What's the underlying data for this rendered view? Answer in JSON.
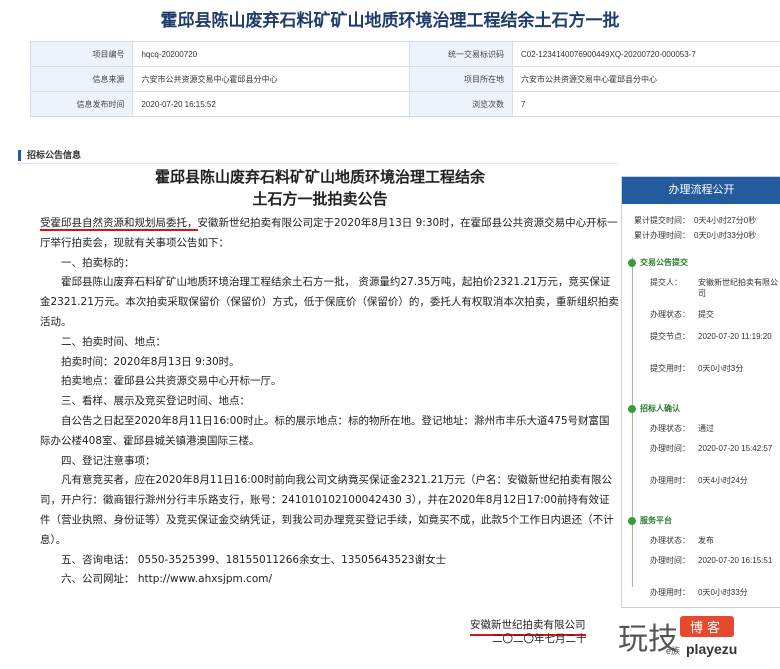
{
  "page_title": "霍邱县陈山废弃石料矿矿山地质环境治理工程结余土石方一批",
  "info": {
    "rows": [
      {
        "l1": "项目编号",
        "v1": "hqcq-20200720",
        "l2": "统一交易标识码",
        "v2": "C02-1234140076900449XQ-20200720-000053-7"
      },
      {
        "l1": "信息来源",
        "v1": "六安市公共资源交易中心霍邱县分中心",
        "l2": "项目所在地",
        "v2": "六安市公共资源交易中心霍邱县分中心"
      },
      {
        "l1": "信息发布时间",
        "v1": "2020-07-20 16:15:52",
        "l2": "浏览次数",
        "v2": "7"
      }
    ]
  },
  "section_title": "招标公告信息",
  "doc": {
    "title_line1": "霍邱县陈山废弃石料矿矿山地质环境治理工程结余",
    "title_line2": "土石方一批拍卖公告",
    "p1_hl": "受霍邱县自然资源和规划局委托，",
    "p1_rest": "安徽新世纪拍卖有限公司定于2020年8月13日 9:30时，在霍邱县公共资源交易中心开标一厅举行拍卖会，现就有关事项公告如下：",
    "h1": "一、拍卖标的：",
    "p2": "霍邱县陈山废弃石料矿矿山地质环境治理工程结余土石方一批， 资源量约27.35万吨，起拍价2321.21万元，竞买保证金2321.21万元。本次拍卖采取保留价（保留价）方式，低于保底价（保留价）的，委托人有权取消本次拍卖，重新组织拍卖活动。",
    "h2": "二、拍卖时间、地点：",
    "p3": "拍卖时间：2020年8月13日 9:30时。",
    "p4": "拍卖地点：霍邱县公共资源交易中心开标一厅。",
    "h3": "三、看样、展示及竞买登记时间、地点：",
    "p5": "自公告之日起至2020年8月11日16:00时止。标的展示地点：标的物所在地。登记地址：滁州市丰乐大道475号财富国际办公楼408室、霍邱县城关镇港澳国际三楼。",
    "h4": "四、登记注意事项：",
    "p6": "凡有意竞买者，应在2020年8月11日16:00时前向我公司文纳竟买保证金2321.21万元（户名：安徽新世纪拍卖有限公司，开户行：徽商银行滁州分行丰乐路支行，账号：241010102100042430 3），并在2020年8月12日17:00前持有效证件（营业执照、身份证等）及竞买保证金交纳凭证，到我公司办理竞买登记手续，如竟买不成，此款5个工作日内退还（不计息）。",
    "h5": "五、咨询电话： 0550-3525399、18155011266余女士、13505643523谢女士",
    "h6": "六、公司网址： http://www.ahxsjpm.com/",
    "sign": "安徽新世纪拍卖有限公司",
    "date": "二〇二〇年七月二十"
  },
  "panel": {
    "title": "办理流程公开",
    "summary": [
      {
        "k": "累计提交时间：",
        "v": "0天4小时27分0秒"
      },
      {
        "k": "累计办理时间：",
        "v": "0天0小时33分0秒"
      }
    ],
    "stages": [
      {
        "name": "交易公告提交",
        "items": [
          {
            "k": "提交人：",
            "v": "安徽新世纪拍卖有限公司"
          },
          {
            "k": "办理状态：",
            "v": "提交"
          },
          {
            "k": "提交节点：",
            "v": "2020-07-20 11:19:20"
          },
          {
            "k": "提交用时：",
            "v": "0天0小时3分"
          }
        ]
      },
      {
        "name": "招标人确认",
        "items": [
          {
            "k": "办理状态：",
            "v": "通过"
          },
          {
            "k": "办理时间：",
            "v": "2020-07-20 15:42:57"
          },
          {
            "k": "办理用时：",
            "v": "0天4小时24分"
          }
        ]
      },
      {
        "name": "服务平台",
        "items": [
          {
            "k": "办理状态：",
            "v": "发布"
          },
          {
            "k": "办理时间：",
            "v": "2020-07-20 16:15:51"
          },
          {
            "k": "办理用时：",
            "v": "0天0小时33分"
          }
        ]
      }
    ]
  },
  "watermark": {
    "big": "玩技",
    "badge": "博客",
    "small": "playezu",
    "tiny": "e族"
  }
}
